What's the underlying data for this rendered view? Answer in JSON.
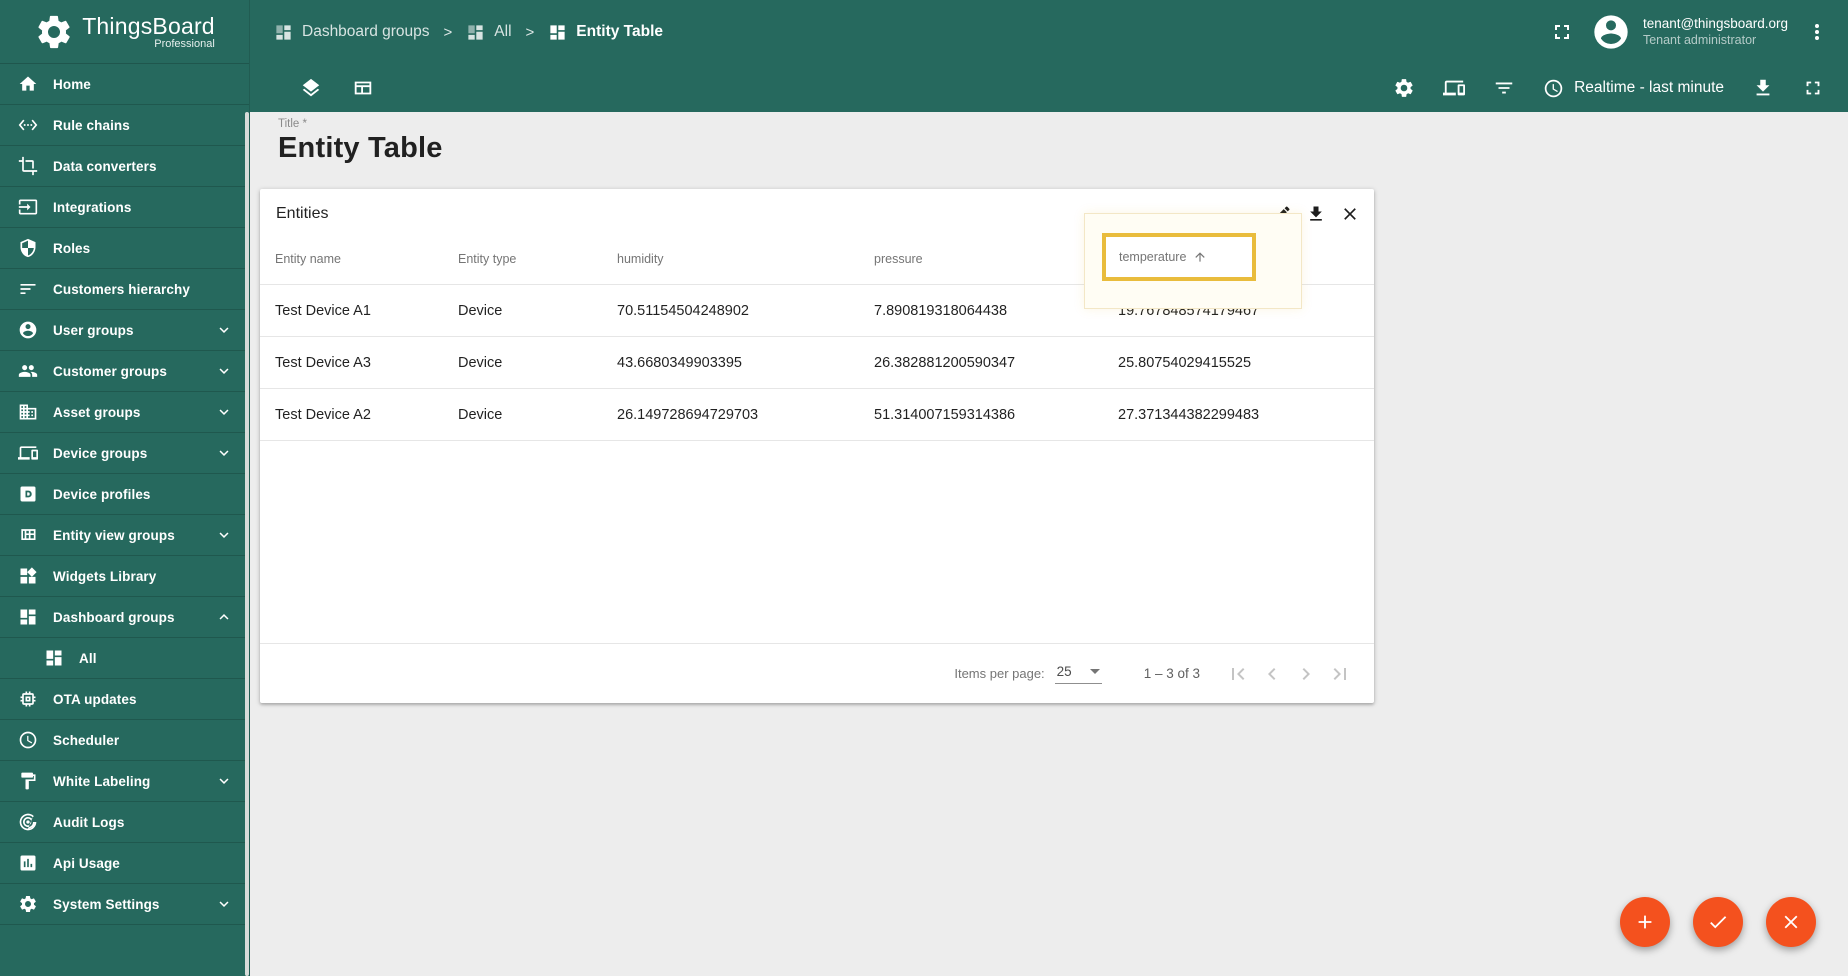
{
  "colors": {
    "teal": "#26695e",
    "accent_orange": "#f4511e",
    "highlight_gold": "#e9bc3c",
    "content_bg": "#ededed"
  },
  "logo": {
    "title": "ThingsBoard",
    "subtitle": "Professional"
  },
  "header": {
    "breadcrumb": [
      {
        "label": "Dashboard groups"
      },
      {
        "label": "All"
      },
      {
        "label": "Entity Table"
      }
    ],
    "separator": ">",
    "user": {
      "email": "tenant@thingsboard.org",
      "role": "Tenant administrator"
    }
  },
  "toolbar": {
    "timewindow_label": "Realtime - last minute"
  },
  "sidebar": {
    "items": [
      {
        "label": "Home"
      },
      {
        "label": "Rule chains"
      },
      {
        "label": "Data converters"
      },
      {
        "label": "Integrations"
      },
      {
        "label": "Roles"
      },
      {
        "label": "Customers hierarchy"
      },
      {
        "label": "User groups",
        "expandable": true,
        "expanded": false
      },
      {
        "label": "Customer groups",
        "expandable": true,
        "expanded": false
      },
      {
        "label": "Asset groups",
        "expandable": true,
        "expanded": false
      },
      {
        "label": "Device groups",
        "expandable": true,
        "expanded": false
      },
      {
        "label": "Device profiles"
      },
      {
        "label": "Entity view groups",
        "expandable": true,
        "expanded": false
      },
      {
        "label": "Widgets Library"
      },
      {
        "label": "Dashboard groups",
        "expandable": true,
        "expanded": true
      },
      {
        "label": "All",
        "sub_item": true
      },
      {
        "label": "OTA updates"
      },
      {
        "label": "Scheduler"
      },
      {
        "label": "White Labeling",
        "expandable": true,
        "expanded": false
      },
      {
        "label": "Audit Logs"
      },
      {
        "label": "Api Usage"
      },
      {
        "label": "System Settings",
        "expandable": true,
        "expanded": false
      }
    ]
  },
  "main": {
    "title_label": "Title *",
    "title_value": "Entity Table"
  },
  "widget": {
    "title": "Entities",
    "table": {
      "columns": [
        "Entity name",
        "Entity type",
        "humidity",
        "pressure",
        "temperature"
      ],
      "sort": {
        "column": "temperature",
        "direction": "asc"
      },
      "rows": [
        [
          "Test Device A1",
          "Device",
          "70.51154504248902",
          "7.890819318064438",
          "19.767848574179467"
        ],
        [
          "Test Device A3",
          "Device",
          "43.6680349903395",
          "26.382881200590347",
          "25.80754029415525"
        ],
        [
          "Test Device A2",
          "Device",
          "26.149728694729703",
          "51.314007159314386",
          "27.371344382299483"
        ]
      ]
    },
    "pagination": {
      "items_per_page_label": "Items per page:",
      "items_per_page": "25",
      "range": "1 – 3 of 3"
    }
  }
}
